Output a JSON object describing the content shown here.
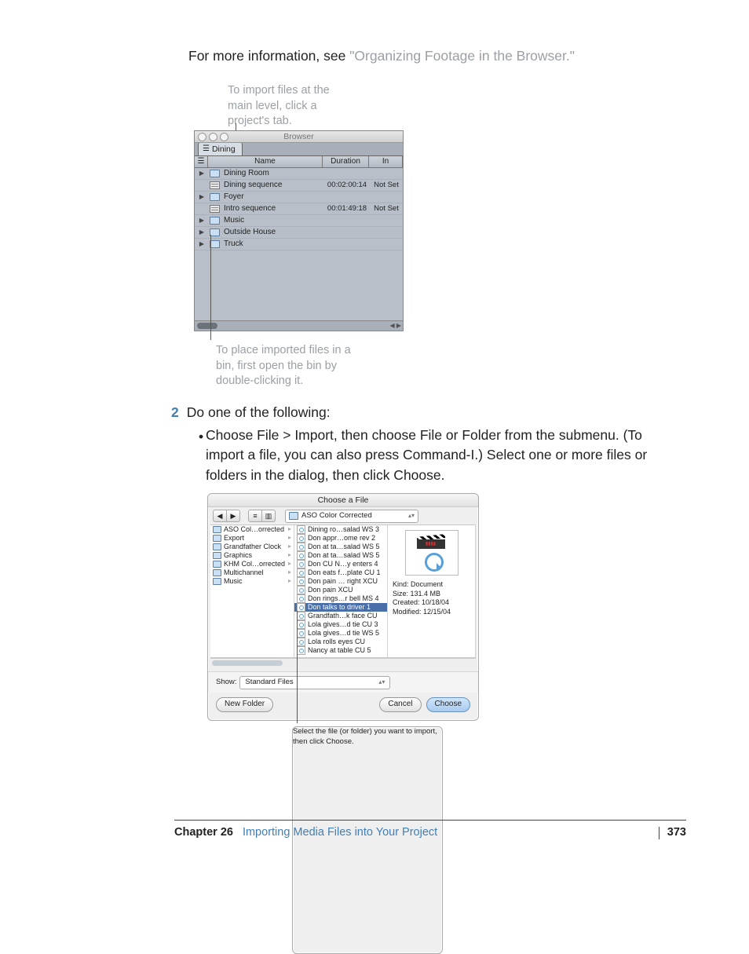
{
  "intro": {
    "prefix": "For more information, see ",
    "link": "\"Organizing Footage in the Browser.\""
  },
  "callouts": {
    "top": "To import files at the main level, click a project's tab.",
    "bottom": "To place imported files in a bin, first open the bin by double-clicking it.",
    "dialog": "Select the file (or folder) you want to import, then click Choose."
  },
  "browser": {
    "title": "Browser",
    "tab": "Dining",
    "columns": {
      "name": "Name",
      "duration": "Duration",
      "in": "In"
    },
    "rows": [
      {
        "type": "folder",
        "name": "Dining Room",
        "dur": "",
        "in": ""
      },
      {
        "type": "seq",
        "name": "Dining sequence",
        "dur": "00:02:00:14",
        "in": "Not Set"
      },
      {
        "type": "folder",
        "name": "Foyer",
        "dur": "",
        "in": ""
      },
      {
        "type": "seq",
        "name": "Intro sequence",
        "dur": "00:01:49:18",
        "in": "Not Set"
      },
      {
        "type": "folder",
        "name": "Music",
        "dur": "",
        "in": ""
      },
      {
        "type": "folder",
        "name": "Outside House",
        "dur": "",
        "in": ""
      },
      {
        "type": "folder",
        "name": "Truck",
        "dur": "",
        "in": ""
      }
    ]
  },
  "step": {
    "num": "2",
    "text": "Do one of the following:"
  },
  "bullet": "Choose File > Import, then choose File or Folder from the submenu. (To import a file, you can also press Command-I.) Select one or more files or folders in the dialog, then click Choose.",
  "dialog": {
    "title": "Choose a File",
    "path": "ASO Color Corrected",
    "colA": [
      "ASO Col…orrected",
      "Export",
      "Grandfather Clock",
      "Graphics",
      "KHM Col…orrected",
      "Multichannel",
      "Music"
    ],
    "colB": [
      "Dining ro…salad WS 3",
      "Don appr…ome rev 2",
      "Don at ta…salad WS 5",
      "Don at ta…salad WS 5",
      "Don CU N…y enters 4",
      "Don eats f…plate CU 1",
      "Don pain … right XCU",
      "Don pain XCU",
      "Don rings…r bell MS 4",
      "Don talks to driver 1",
      "Grandfath…k face CU",
      "Lola gives…d tie CU 3",
      "Lola gives…d tie WS 5",
      "Lola rolls eyes CU",
      "Nancy at table CU 5"
    ],
    "selectedB": 9,
    "preview": {
      "kind": "Kind: Document",
      "size": "Size: 131.4 MB",
      "created": "Created: 10/18/04",
      "modified": "Modified: 12/15/04"
    },
    "showLabel": "Show:",
    "showValue": "Standard Files",
    "buttons": {
      "new": "New Folder",
      "cancel": "Cancel",
      "choose": "Choose"
    }
  },
  "footer": {
    "chapter": "Chapter 26",
    "title": "Importing Media Files into Your Project",
    "page": "373"
  }
}
